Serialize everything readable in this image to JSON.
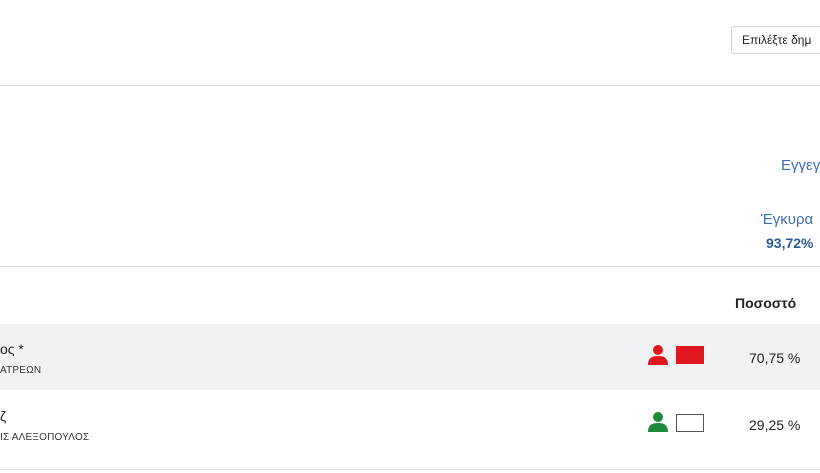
{
  "topbar": {
    "select_label": "Επιλέξτε δημ"
  },
  "stats": {
    "registered_label": "Εγγεγ",
    "valid_label": "Έγκυρα",
    "valid_value": "93,72%"
  },
  "table": {
    "header_percent": "Ποσοστό",
    "rows": [
      {
        "name": "ος *",
        "party": "ΑΤΡΕΩΝ",
        "percent": "70,75 %",
        "icon_color": "#e0171e",
        "flag_color": "#e0171e"
      },
      {
        "name": "ζ",
        "party": "ΙΣ ΑΛΕΞΟΠΟΥΛΟΣ",
        "percent": "29,25 %",
        "icon_color": "#1e8a3c",
        "flag_color": "#ffffff"
      }
    ]
  }
}
